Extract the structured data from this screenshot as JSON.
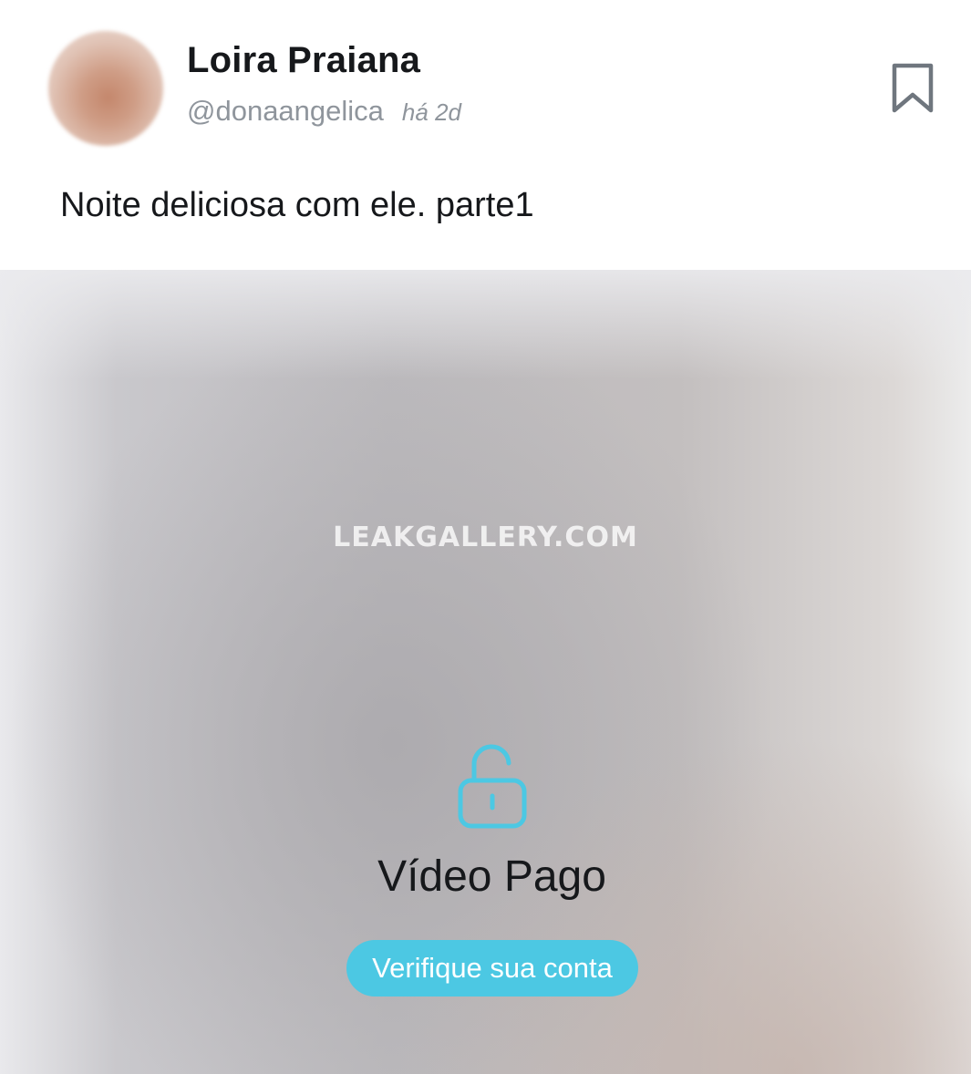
{
  "post": {
    "author": {
      "display_name": "Loira Praiana",
      "handle": "@donaangelica",
      "time_ago": "há 2d",
      "avatar": "blurred-avatar"
    },
    "caption": "Noite deliciosa com ele. parte1",
    "bookmark_icon": "bookmark-icon"
  },
  "media": {
    "watermark": "LEAKGALLERY.COM",
    "lock_icon": "unlocked-padlock-icon",
    "paid_label": "Vídeo Pago",
    "verify_button_label": "Verifique sua conta"
  },
  "colors": {
    "accent": "#4cc8e3",
    "text_primary": "#16181b",
    "text_secondary": "#8f959c",
    "bookmark": "#6f767e"
  }
}
